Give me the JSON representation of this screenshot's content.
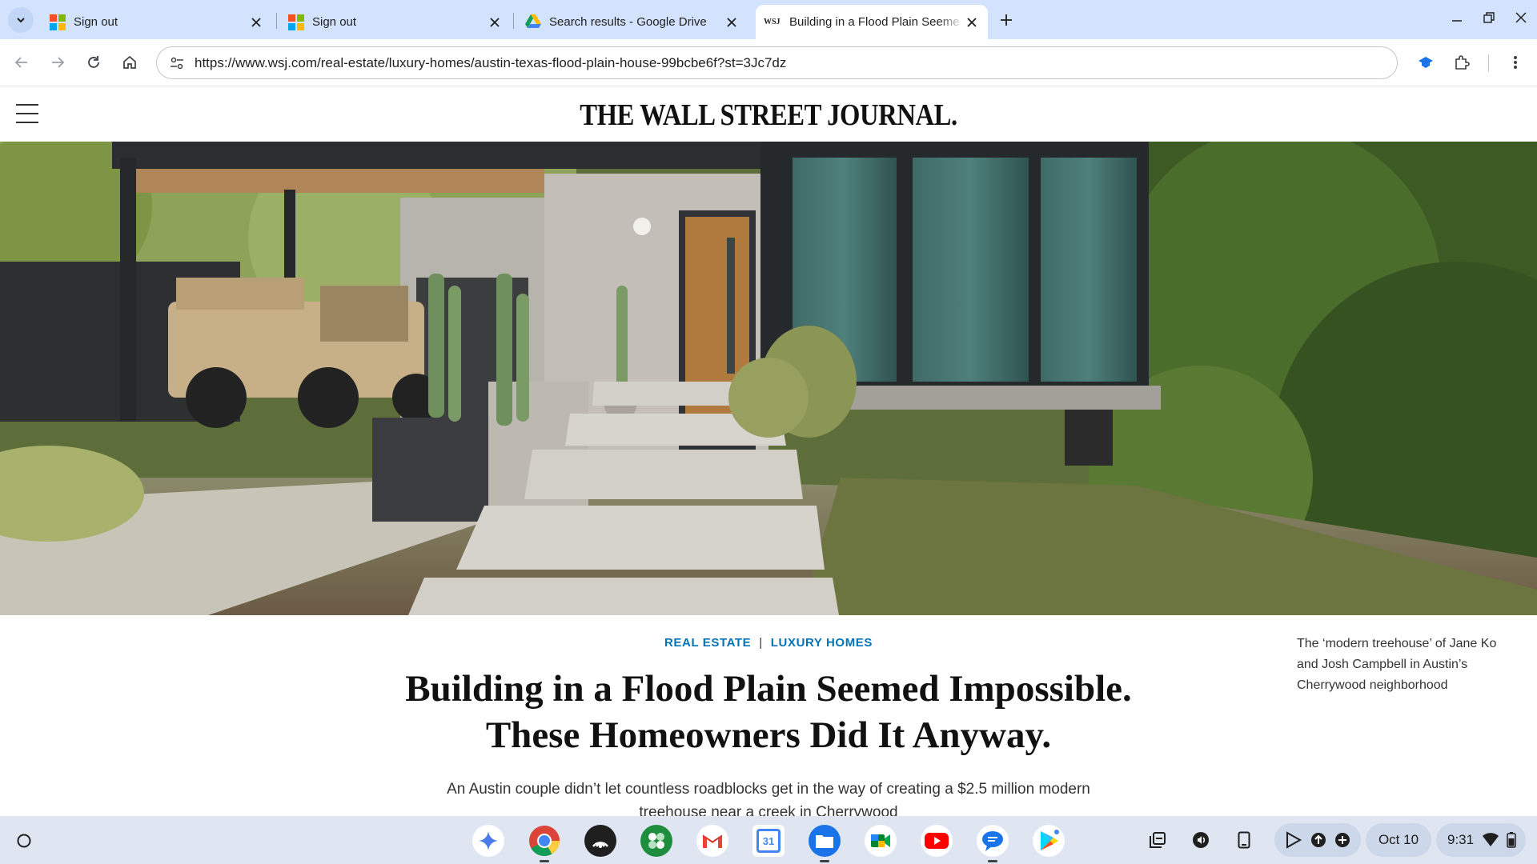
{
  "browser": {
    "tabs": [
      {
        "title": "Sign out",
        "favicon": "microsoft-logo",
        "active": false
      },
      {
        "title": "Sign out",
        "favicon": "microsoft-logo",
        "active": false
      },
      {
        "title": "Search results - Google Drive",
        "favicon": "google-drive-icon",
        "active": false
      },
      {
        "title": "Building in a Flood Plain Seeme",
        "favicon_text": "WSJ",
        "active": true
      }
    ],
    "url": "https://www.wsj.com/real-estate/luxury-homes/austin-texas-flood-plain-house-99bcbe6f?st=3Jc7dz"
  },
  "site": {
    "masthead": "THE WALL STREET JOURNAL."
  },
  "article": {
    "section": "REAL ESTATE",
    "section_separator": "|",
    "subsection": "LUXURY HOMES",
    "headline_line1": "Building in a Flood Plain Seemed Impossible.",
    "headline_line2": "These Homeowners Did It Anyway.",
    "dek": "An Austin couple didn’t let countless roadblocks get in the way of creating a $2.5 million modern treehouse near a creek in Cherrywood",
    "caption": "The ‘modern treehouse’ of Jane Ko and Josh Campbell in Austin’s Cherrywood neighborhood"
  },
  "shelf": {
    "apps": [
      "gemini-icon",
      "chrome-icon",
      "podcast-icon",
      "google-one-icon",
      "gmail-icon",
      "calendar-icon",
      "files-icon",
      "meet-icon",
      "youtube-icon",
      "messages-icon",
      "play-store-icon"
    ],
    "calendar_day": "31",
    "date": "Oct 10",
    "time": "9:31"
  },
  "colors": {
    "tabstrip": "#d3e3fd",
    "link_blue": "#0274b6",
    "shelf": "#dfe6f2"
  }
}
